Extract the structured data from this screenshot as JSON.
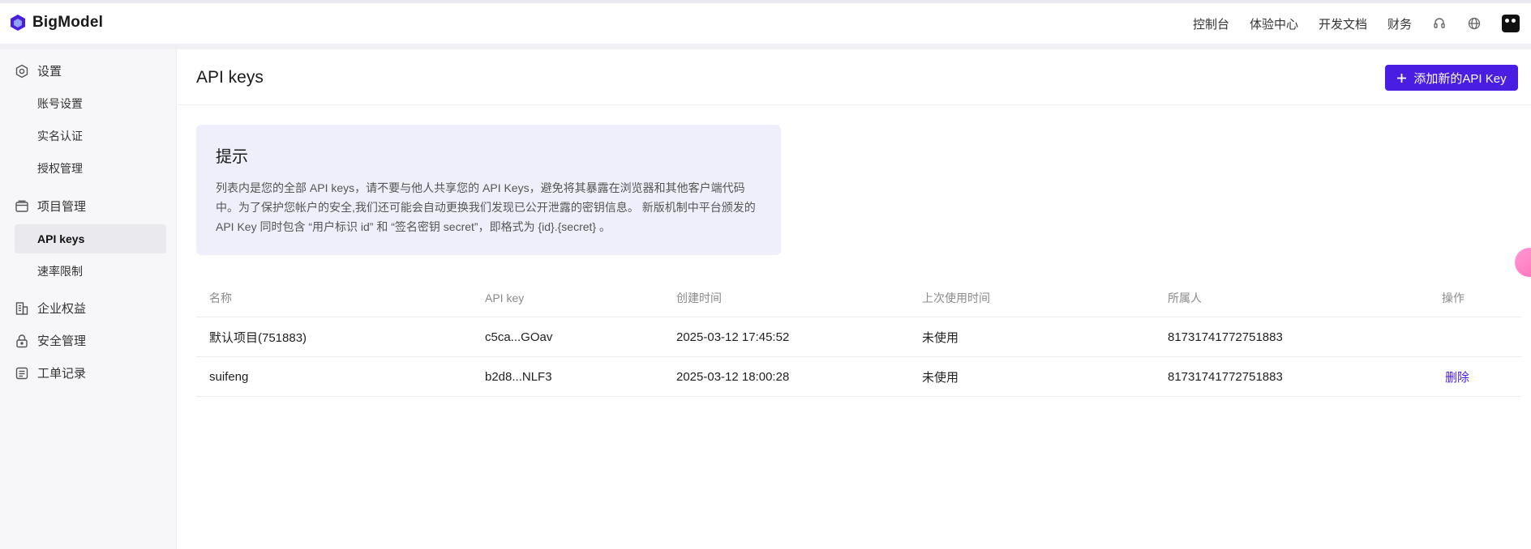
{
  "brand": {
    "name": "BigModel",
    "logo_color": "#4a1de2"
  },
  "header": {
    "nav": [
      "控制台",
      "体验中心",
      "开发文档",
      "财务"
    ],
    "icons": [
      "headset-icon",
      "globe-icon",
      "avatar"
    ]
  },
  "sidebar": {
    "groups": [
      {
        "label": "设置",
        "icon": "settings-icon",
        "items": [
          {
            "label": "账号设置"
          },
          {
            "label": "实名认证"
          },
          {
            "label": "授权管理"
          }
        ]
      },
      {
        "label": "项目管理",
        "icon": "folder-icon",
        "items": [
          {
            "label": "API keys",
            "active": true
          },
          {
            "label": "速率限制"
          }
        ]
      },
      {
        "label": "企业权益",
        "icon": "building-icon",
        "items": []
      },
      {
        "label": "安全管理",
        "icon": "lock-icon",
        "items": []
      },
      {
        "label": "工单记录",
        "icon": "ticket-icon",
        "items": []
      }
    ]
  },
  "main": {
    "title": "API keys",
    "add_button": "添加新的API Key",
    "notice": {
      "title": "提示",
      "lines": [
        "列表内是您的全部 API keys，请不要与他人共享您的 API Keys，避免将其暴露在浏览器和其他客户端代码",
        "中。为了保护您帐户的安全,我们还可能会自动更换我们发现已公开泄露的密钥信息。 新版机制中平台颁发的",
        "API Key 同时包含 “用户标识 id” 和 “签名密钥 secret”，即格式为 {id}.{secret} 。"
      ]
    },
    "table": {
      "columns": [
        "名称",
        "API key",
        "创建时间",
        "上次使用时间",
        "所属人",
        "操作"
      ],
      "rows": [
        {
          "name": "默认项目(751883)",
          "key": "c5ca...GOav",
          "created": "2025-03-12 17:45:52",
          "last_used": "未使用",
          "owner": "81731741772751883",
          "action": ""
        },
        {
          "name": "suifeng",
          "key": "b2d8...NLF3",
          "created": "2025-03-12 18:00:28",
          "last_used": "未使用",
          "owner": "81731741772751883",
          "action": "删除"
        }
      ]
    }
  },
  "colors": {
    "primary": "#4a1de2",
    "notice_bg": "#efeffb",
    "sidebar_bg": "#f7f7f9"
  }
}
